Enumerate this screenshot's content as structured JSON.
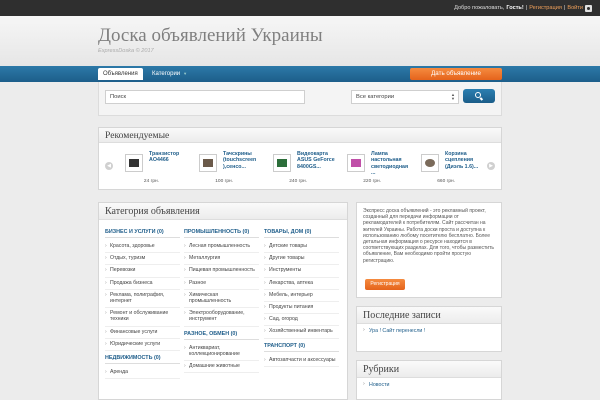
{
  "topbar": {
    "welcome": "Добро пожаловать,",
    "guest": "Гость!",
    "sep1": "|",
    "register": "Регистрация",
    "sep2": "|",
    "login": "Войти"
  },
  "header": {
    "title": "Доска объявлений Украины",
    "tagline": "ExpressDoska © 2017"
  },
  "nav": {
    "tabs": [
      "Объявления",
      "Категории"
    ],
    "post_ad": "Дать объявление"
  },
  "search": {
    "placeholder": "Поиск",
    "category": "Все категории"
  },
  "featured": {
    "title": "Рекомендуемые",
    "items": [
      {
        "title": "Транзистор AO4466",
        "price": "24 грн."
      },
      {
        "title": "Тачскрины (touchscreen ),сенсо...",
        "price": "100 грн."
      },
      {
        "title": "Видеокарта ASUS GeForce 8400GS...",
        "price": "240 грн."
      },
      {
        "title": "Лампа настольная светодиодная ...",
        "price": "220 грн."
      },
      {
        "title": "Корзина сцепления (Диэль 1.6)...",
        "price": "660 грн."
      }
    ]
  },
  "categories": {
    "title": "Категория объявления",
    "col1": [
      {
        "head": "БИЗНЕС И УСЛУГИ (0)",
        "items": [
          "Красота, здоровье",
          "Отдых, туризм",
          "Перевозки",
          "Продажа бизнеса",
          "Реклама, полиграфия, интернет",
          "Ремонт и обслуживание техники",
          "Финансовые услуги",
          "Юридические услуги"
        ]
      },
      {
        "head": "НЕДВИЖИМОСТЬ (0)",
        "items": [
          "Аренда"
        ]
      }
    ],
    "col2": [
      {
        "head": "ПРОМЫШЛЕННОСТЬ (0)",
        "items": [
          "Лесная промышленность",
          "Металлургия",
          "Пищевая промышленность",
          "Разное",
          "Химическая промышленность",
          "Электрооборудование, инструмент"
        ]
      },
      {
        "head": "РАЗНОЕ, ОБМЕН (0)",
        "items": [
          "Антиквариат, коллекционирование",
          "Домашние животные"
        ]
      }
    ],
    "col3": [
      {
        "head": "ТОВАРЫ, ДОМ (0)",
        "items": [
          "Детские товары",
          "Другие товары",
          "Инструменты",
          "Лекарства, аптека",
          "Мебель, интерьер",
          "Продукты питания",
          "Сад, огород",
          "Хозяйственный инвентарь"
        ]
      },
      {
        "head": "ТРАНСПОРТ (0)",
        "items": [
          "Автозапчасти и аксессуары"
        ]
      }
    ]
  },
  "sidebar": {
    "about": "Экспресс доска объявлений - это рекламный проект, созданный для передачи информации от рекламодателей к потребителям. Сайт рассчитан на жителей Украины. Работа доски проста и доступна к использованию любому посетителю бесплатно. Более детальная информация о ресурсе находится в соответствующих разделах. Для того, чтобы разместить объявление, Вам необходимо пройти простую регистрацию.",
    "register_btn": "Регистрация",
    "recent_title": "Последние записи",
    "recent": [
      "Ура ! Сайт перенесли !"
    ],
    "rubrics_title": "Рубрики",
    "rubrics": [
      "Новости"
    ]
  }
}
